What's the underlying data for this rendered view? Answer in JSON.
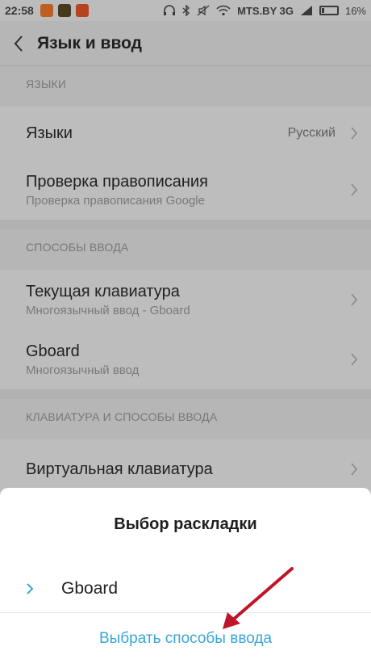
{
  "status_bar": {
    "time": "22:58",
    "carrier": "MTS.BY 3G",
    "battery_level": "16%",
    "battery_fraction": 0.16
  },
  "header": {
    "title": "Язык и ввод",
    "back_icon": "chevron-left-icon"
  },
  "sections": [
    {
      "header": "ЯЗЫКИ",
      "items": [
        {
          "label": "Языки",
          "value": "Русский",
          "subtitle": ""
        },
        {
          "label": "Проверка правописания",
          "subtitle": "Проверка правописания Google"
        }
      ]
    },
    {
      "header": "СПОСОБЫ ВВОДА",
      "items": [
        {
          "label": "Текущая клавиатура",
          "subtitle": "Многоязычный ввод - Gboard"
        },
        {
          "label": "Gboard",
          "subtitle": "Многоязычный ввод"
        }
      ]
    },
    {
      "header": "КЛАВИАТУРА И СПОСОБЫ ВВОДА",
      "items": [
        {
          "label": "Виртуальная клавиатура"
        }
      ]
    }
  ],
  "dialog": {
    "title": "Выбор раскладки",
    "item_label": "Gboard",
    "action_label": "Выбрать способы ввода"
  },
  "colors": {
    "accent": "#3aa6d8",
    "arrow": "#c0142a"
  }
}
